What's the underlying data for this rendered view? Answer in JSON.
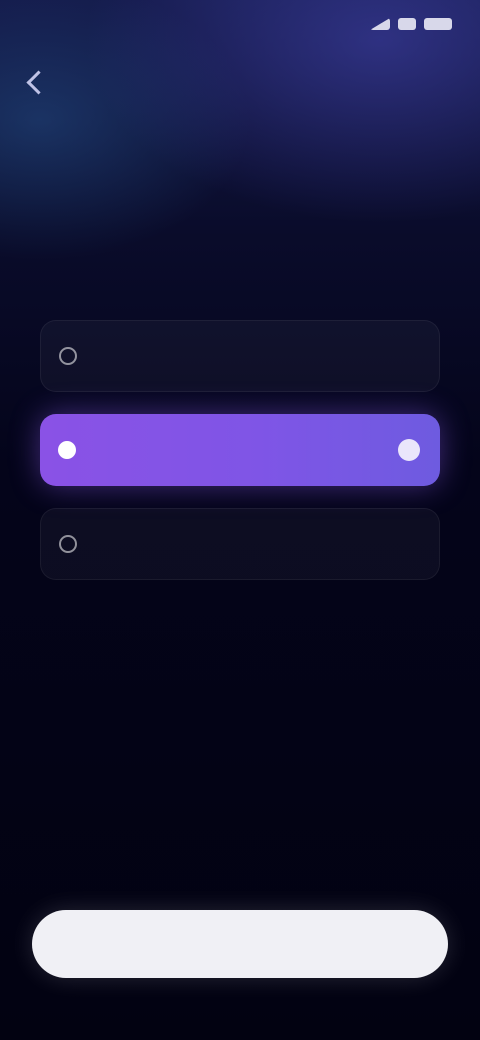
{
  "status_bar": {
    "time": ""
  },
  "header": {
    "back_label": ""
  },
  "title": "",
  "options": [
    {
      "label": "",
      "selected": false
    },
    {
      "label": "",
      "selected": true
    },
    {
      "label": "",
      "selected": false
    }
  ],
  "cta": {
    "label": ""
  },
  "colors": {
    "accent": "#8a52e6",
    "background": "#04041a",
    "cta_bg": "#f0f0f5"
  },
  "icons": {
    "back": "chevron-left-icon",
    "radio": "radio-icon",
    "selected": "check-icon"
  }
}
